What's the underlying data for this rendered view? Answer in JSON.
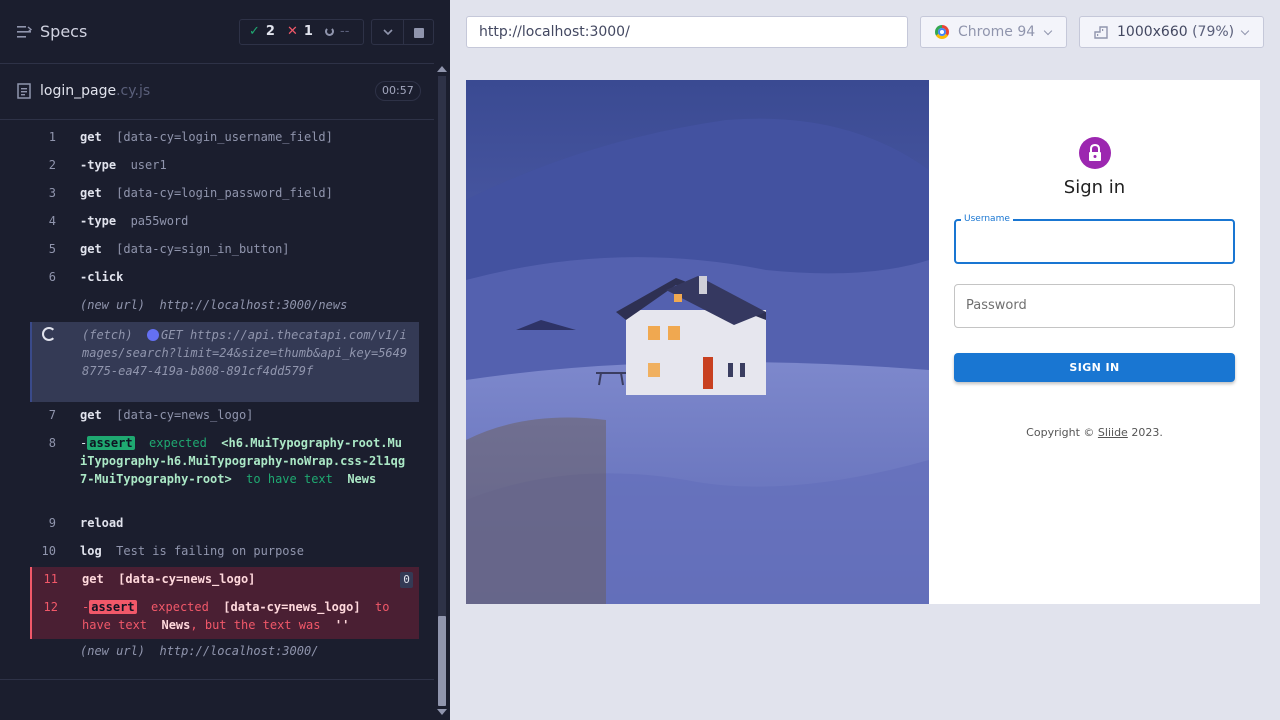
{
  "reporter": {
    "title": "Specs",
    "stats": {
      "passed": "2",
      "failed": "1",
      "pending": "--"
    },
    "file": {
      "name": "login_page",
      "ext": ".cy.js",
      "duration": "00:57"
    },
    "commands": [
      {
        "num": "1",
        "name": "get",
        "arg": "[data-cy=login_username_field]"
      },
      {
        "num": "2",
        "name": "-type",
        "arg": "user1"
      },
      {
        "num": "3",
        "name": "get",
        "arg": "[data-cy=login_password_field]"
      },
      {
        "num": "4",
        "name": "-type",
        "arg": "pa55word"
      },
      {
        "num": "5",
        "name": "get",
        "arg": "[data-cy=sign_in_button]"
      },
      {
        "num": "6",
        "name": "-click",
        "arg": ""
      },
      {
        "num": "",
        "name": "(new url)",
        "arg": "http://localhost:3000/news"
      },
      {
        "num": "",
        "name": "(fetch)",
        "method": "GET",
        "arg": "https://api.thecatapi.com/v1/images/search?limit=24&size=thumb&api_key=56498775-ea47-419a-b808-891cf4dd579f"
      },
      {
        "num": "7",
        "name": "get",
        "arg": "[data-cy=news_logo]"
      },
      {
        "num": "8",
        "name": "assert",
        "expected": "expected",
        "subject": "<h6.MuiTypography-root.MuiTypography-h6.MuiTypography-noWrap.css-2l1qg7-MuiTypography-root>",
        "verb": "to have text",
        "value": "News"
      },
      {
        "num": "9",
        "name": "reload",
        "arg": ""
      },
      {
        "num": "10",
        "name": "log",
        "arg": "Test is failing on purpose"
      },
      {
        "num": "11",
        "name": "get",
        "arg": "[data-cy=news_logo]",
        "badge": "0"
      },
      {
        "num": "12",
        "name": "assert",
        "expected": "expected",
        "subject": "[data-cy=news_logo]",
        "verb": "to have text",
        "value": "News",
        "tail": ", but the text was",
        "tail_value": "''"
      },
      {
        "num": "",
        "name": "(new url)",
        "arg": "http://localhost:3000/"
      }
    ]
  },
  "browser": {
    "url": "http://localhost:3000/",
    "name": "Chrome 94",
    "viewport": "1000x660",
    "scale": "(79%)"
  },
  "app": {
    "title": "Sign in",
    "username_label": "Username",
    "password_placeholder": "Password",
    "button": "SIGN IN",
    "copyright_prefix": "Copyright ©",
    "copyright_link": "Sliide",
    "copyright_suffix": "2023."
  },
  "colors": {
    "pass": "#1fa971",
    "fail": "#f15869",
    "primary": "#1976d2",
    "avatar": "#9c27b0"
  }
}
